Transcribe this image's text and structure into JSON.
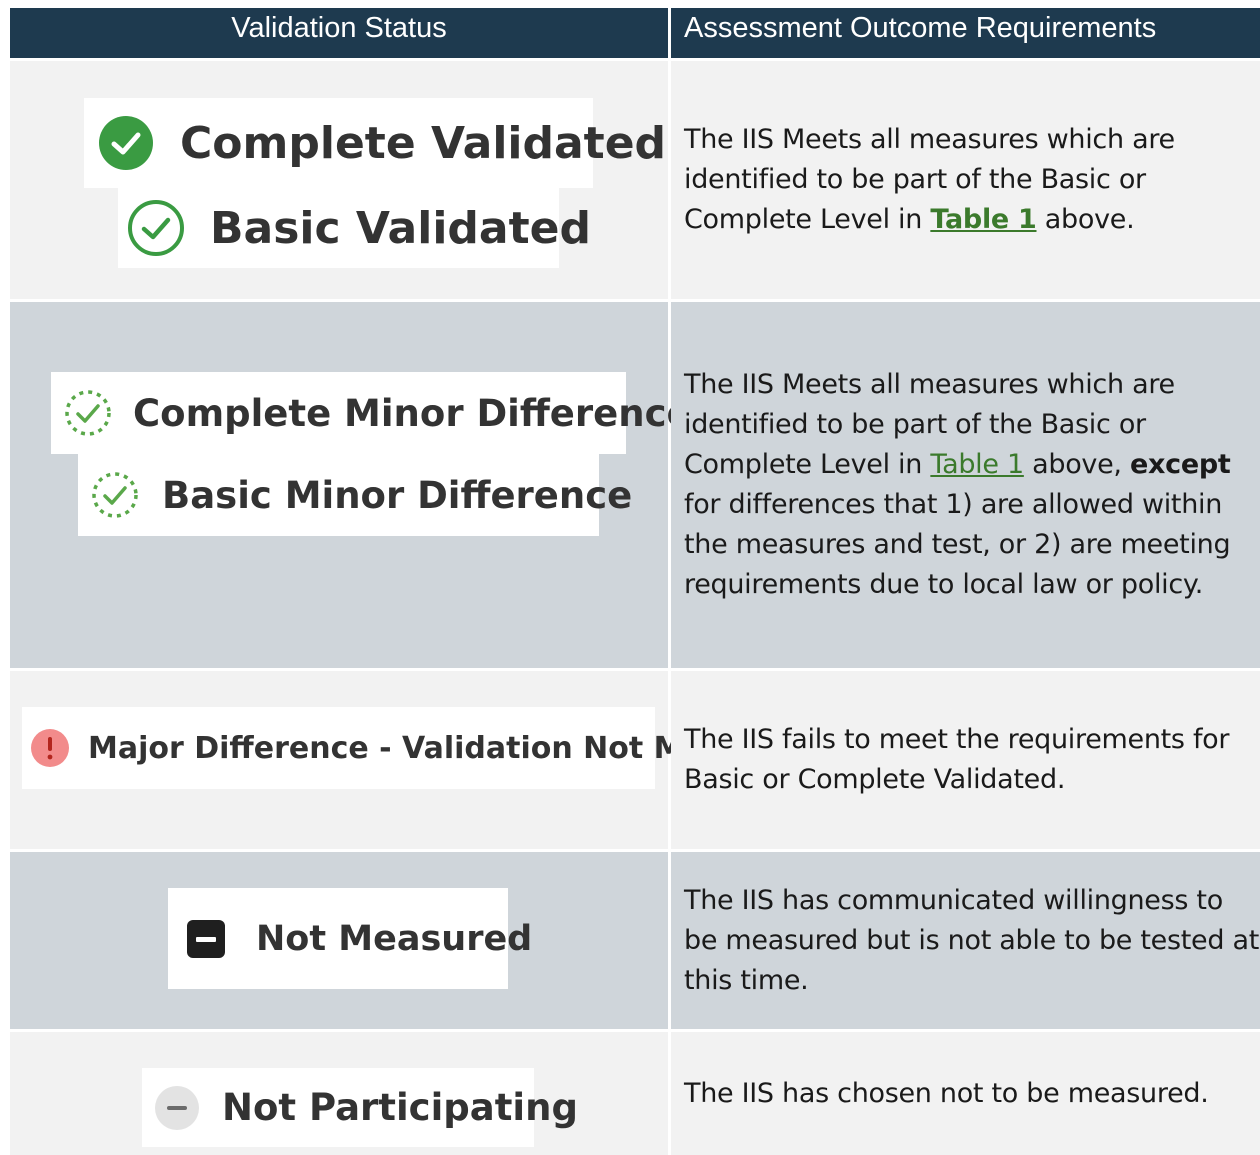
{
  "header": {
    "status_col": "Validation Status",
    "requirements_col": "Assessment Outcome Requirements"
  },
  "rows": [
    {
      "statuses": [
        "Complete Validated",
        "Basic Validated"
      ],
      "requirement": {
        "before": "The IIS Meets all measures which are identified to be part of the Basic or Complete Level in ",
        "link": "Table 1",
        "after": " above."
      }
    },
    {
      "statuses": [
        "Complete Minor Difference",
        "Basic Minor Difference"
      ],
      "requirement": {
        "before": "The IIS Meets all measures which are identified to be part of the Basic or Complete Level in ",
        "link": "Table 1",
        "middle": " above, ",
        "bold": "except",
        "after": " for differences that 1) are allowed within the measures and test, or 2) are meeting requirements due to local law or policy."
      }
    },
    {
      "statuses": [
        "Major Difference - Validation Not Met"
      ],
      "requirement": {
        "text": "The IIS fails to meet the requirements for Basic or Complete Validated."
      }
    },
    {
      "statuses": [
        "Not Measured"
      ],
      "requirement": {
        "text": "The IIS has communicated willingness to be measured but is not able to be tested at this time."
      }
    },
    {
      "statuses": [
        "Not Participating"
      ],
      "requirement": {
        "text": "The IIS has chosen not to be measured."
      }
    }
  ],
  "icons": {
    "complete_validated": "check-circle-filled-icon",
    "basic_validated": "check-circle-outline-icon",
    "minor_difference": "check-circle-dotted-icon",
    "major_difference": "exclamation-circle-icon",
    "not_measured": "minus-square-icon",
    "not_participating": "minus-circle-icon"
  },
  "colors": {
    "header_bg": "#1e3a4f",
    "validated_green": "#3a9b42",
    "minor_green": "#5aa84a",
    "major_red": "#f28b8b",
    "link_green": "#3b7a2c",
    "row_light": "#f2f2f2",
    "row_gray": "#cfd5da"
  }
}
